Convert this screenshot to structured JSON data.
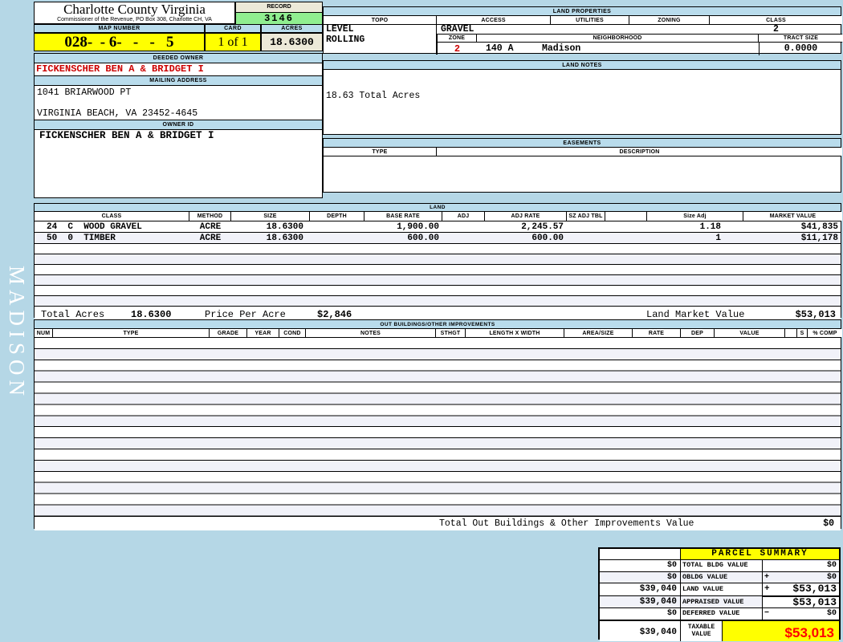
{
  "watermark": "MADISON",
  "header": {
    "county_title": "Charlotte County Virginia",
    "county_subtitle": "Commissioner of the Revenue, PO Box 308, Charlotte CH, VA",
    "record_label": "RECORD",
    "record_value": "3146",
    "map_number_label": "MAP NUMBER",
    "map_number_value": "028-  - 6-   -   -   5",
    "card_label": "CARD",
    "card_value": "1 of 1",
    "acres_label": "ACRES",
    "acres_value": "18.6300"
  },
  "owner": {
    "deeded_owner_label": "DEEDED OWNER",
    "deeded_owner": "FICKENSCHER BEN A & BRIDGET I",
    "mailing_address_label": "MAILING ADDRESS",
    "address_line1": "1041 BRIARWOOD PT",
    "address_line2": "VIRGINIA BEACH, VA 23452-4645",
    "owner_id_label": "OWNER ID",
    "owner_id": "FICKENSCHER BEN A & BRIDGET I"
  },
  "land_properties": {
    "title": "LAND PROPERTIES",
    "topo_label": "TOPO",
    "access_label": "ACCESS",
    "utilities_label": "UTILITIES",
    "zoning_label": "ZONING",
    "class_label": "CLASS",
    "topo_value1": "LEVEL",
    "topo_value2": "ROLLING",
    "access_value": "GRAVEL",
    "class_value": "2",
    "zone_label": "ZONE",
    "neighborhood_label": "NEIGHBORHOOD",
    "tract_size_label": "TRACT SIZE",
    "zone_value": "2",
    "neighborhood_code": "140 A",
    "neighborhood_name": "Madison",
    "tract_size_value": "0.0000"
  },
  "land_notes": {
    "title": "LAND NOTES",
    "note": "18.63 Total Acres"
  },
  "easements": {
    "title": "EASEMENTS",
    "type_label": "TYPE",
    "description_label": "DESCRIPTION"
  },
  "land": {
    "title": "LAND",
    "headers": {
      "class": "CLASS",
      "method": "METHOD",
      "size": "SIZE",
      "depth": "DEPTH",
      "base_rate": "BASE RATE",
      "adj": "ADJ",
      "adj_rate": "ADJ RATE",
      "sz_adj_tbl": "SZ ADJ TBL",
      "blank": "",
      "size_adj": "Size Adj",
      "market_value": "MARKET VALUE"
    },
    "rows": [
      {
        "class": "24  C  WOOD GRAVEL",
        "method": "ACRE",
        "size": "18.6300",
        "depth": "",
        "base_rate": "1,900.00",
        "adj": "",
        "adj_rate": "2,245.57",
        "sz_adj_tbl": "",
        "size_adj": "1.18",
        "market_value": "$41,835"
      },
      {
        "class": "50  0  TIMBER",
        "method": "ACRE",
        "size": "18.6300",
        "depth": "",
        "base_rate": "600.00",
        "adj": "",
        "adj_rate": "600.00",
        "sz_adj_tbl": "",
        "size_adj": "1",
        "market_value": "$11,178"
      }
    ],
    "totals": {
      "total_acres_label": "Total Acres",
      "total_acres_value": "18.6300",
      "price_per_acre_label": "Price Per Acre",
      "price_per_acre_value": "$2,846",
      "land_market_value_label": "Land Market Value",
      "land_market_value": "$53,013"
    }
  },
  "outbuildings": {
    "title": "OUT BUILDINGS/OTHER IMPROVEMENTS",
    "headers": {
      "num": "NUM",
      "type": "TYPE",
      "grade": "GRADE",
      "year": "YEAR",
      "cond": "COND",
      "notes": "NOTES",
      "sthgt": "STHGT",
      "length_x_width": "LENGTH X WIDTH",
      "area_size": "AREA/SIZE",
      "rate": "RATE",
      "dep": "DEP",
      "value": "VALUE",
      "blank": "",
      "s": "S",
      "pct_comp": "% COMP"
    },
    "total_label": "Total Out Buildings & Other Improvements Value",
    "total_value": "$0"
  },
  "parcel_summary": {
    "title": "PARCEL SUMMARY",
    "rows": [
      {
        "left": "$0",
        "label": "TOTAL BLDG VALUE",
        "op": "",
        "value": "$0"
      },
      {
        "left": "$0",
        "label": "OBLDG VALUE",
        "op": "+",
        "value": "$0"
      },
      {
        "left": "$39,040",
        "label": "LAND VALUE",
        "op": "+",
        "value": "$53,013"
      },
      {
        "left": "$39,040",
        "label": "APPRAISED VALUE",
        "op": "",
        "value": "$53,013"
      },
      {
        "left": "$0",
        "label": "DEFERRED VALUE",
        "op": "−",
        "value": "$0"
      }
    ],
    "taxable": {
      "left": "$39,040",
      "label": "TAXABLE VALUE",
      "value": "$53,013"
    }
  },
  "colors": {
    "page_bg": "#b5d7e6",
    "band_bg": "#b9dcec",
    "highlight_yellow": "#ffff00",
    "record_green": "#90ee90",
    "beige": "#ece9d8",
    "owner_red": "#cc0000",
    "taxable_red": "#ff0000",
    "stripe": "#f1f2f9"
  }
}
